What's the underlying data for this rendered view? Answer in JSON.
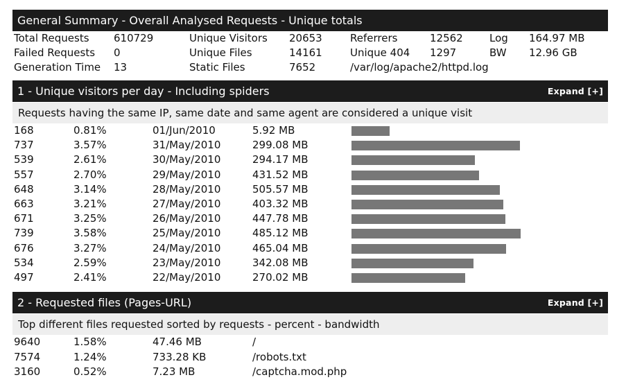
{
  "general": {
    "title": "General Summary - Overall Analysed Requests - Unique totals",
    "rows": [
      [
        "Total Requests",
        "610729",
        "Unique Visitors",
        "20653",
        "Referrers",
        "12562",
        "Log",
        "164.97 MB"
      ],
      [
        "Failed Requests",
        "0",
        "Unique Files",
        "14161",
        "Unique 404",
        "1297",
        "BW",
        "12.96 GB"
      ],
      [
        "Generation Time",
        "13",
        "Static Files",
        "7652",
        "/var/log/apache2/httpd.log",
        "",
        "",
        ""
      ]
    ]
  },
  "visitors": {
    "title": "1 - Unique visitors per day - Including spiders",
    "expand_label": "Expand [+]",
    "description": "Requests having the same IP, same date and same agent are considered a unique visit",
    "rows": [
      {
        "hits": "168",
        "percent": "0.81%",
        "date": "01/Jun/2010",
        "bandwidth": "5.92 MB",
        "bar": 0.227
      },
      {
        "hits": "737",
        "percent": "3.57%",
        "date": "31/May/2010",
        "bandwidth": "299.08 MB",
        "bar": 0.997
      },
      {
        "hits": "539",
        "percent": "2.61%",
        "date": "30/May/2010",
        "bandwidth": "294.17 MB",
        "bar": 0.729
      },
      {
        "hits": "557",
        "percent": "2.70%",
        "date": "29/May/2010",
        "bandwidth": "431.52 MB",
        "bar": 0.754
      },
      {
        "hits": "648",
        "percent": "3.14%",
        "date": "28/May/2010",
        "bandwidth": "505.57 MB",
        "bar": 0.877
      },
      {
        "hits": "663",
        "percent": "3.21%",
        "date": "27/May/2010",
        "bandwidth": "403.32 MB",
        "bar": 0.897
      },
      {
        "hits": "671",
        "percent": "3.25%",
        "date": "26/May/2010",
        "bandwidth": "447.78 MB",
        "bar": 0.908
      },
      {
        "hits": "739",
        "percent": "3.58%",
        "date": "25/May/2010",
        "bandwidth": "485.12 MB",
        "bar": 1.0
      },
      {
        "hits": "676",
        "percent": "3.27%",
        "date": "24/May/2010",
        "bandwidth": "465.04 MB",
        "bar": 0.915
      },
      {
        "hits": "534",
        "percent": "2.59%",
        "date": "23/May/2010",
        "bandwidth": "342.08 MB",
        "bar": 0.723
      },
      {
        "hits": "497",
        "percent": "2.41%",
        "date": "22/May/2010",
        "bandwidth": "270.02 MB",
        "bar": 0.673
      }
    ]
  },
  "files": {
    "title": "2 - Requested files (Pages-URL)",
    "expand_label": "Expand [+]",
    "description": "Top different files requested sorted by requests - percent - bandwidth",
    "rows": [
      {
        "hits": "9640",
        "percent": "1.58%",
        "bandwidth": "47.46 MB",
        "path": "/"
      },
      {
        "hits": "7574",
        "percent": "1.24%",
        "bandwidth": "733.28 KB",
        "path": "/robots.txt"
      },
      {
        "hits": "3160",
        "percent": "0.52%",
        "bandwidth": "7.23 MB",
        "path": "/captcha.mod.php"
      }
    ]
  }
}
